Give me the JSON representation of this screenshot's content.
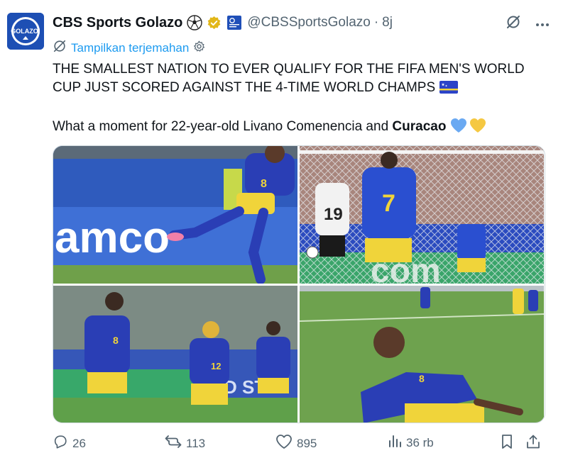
{
  "post": {
    "author_name": "CBS Sports Golazo",
    "handle": "@CBSSportsGolazo",
    "separator": "·",
    "time": "8j",
    "avatar_text": "GOLAZO!",
    "translate_label": "Tampilkan terjemahan",
    "text_line1": "THE SMALLEST NATION TO EVER QUALIFY FOR THE FIFA MEN'S WORLD",
    "text_line2": "CUP JUST SCORED AGAINST THE 4-TIME WORLD CHAMPS",
    "text_line3_prefix": "What a moment for 22-year-old Livano Comenencia and ",
    "text_line3_bold": "Curacao"
  },
  "media": {
    "photo1": {
      "banner_text": "amco",
      "jersey_number": "8"
    },
    "photo2": {
      "player_number_white": "19",
      "player_number_blue": "7"
    },
    "photo3": {
      "jersey_left": "8",
      "jersey_mid": "12"
    },
    "photo4": {
      "jersey": "8"
    }
  },
  "actions": {
    "replies": "26",
    "reposts": "113",
    "likes": "895",
    "views": "36 rb"
  },
  "colors": {
    "link_blue": "#1d9bf0",
    "muted_gray": "#536471",
    "brand_blue": "#1d4fb4",
    "verified_gold": "#e2b719",
    "curacao_blue": "#2b43c8",
    "curacao_yellow": "#f0d43a"
  },
  "icons": {
    "ball": "soccer-ball-icon",
    "verified": "verified-badge-icon",
    "affiliate": "cbs-sports-affiliate-icon",
    "grok": "grok-icon",
    "more": "more-options-icon",
    "translate": "translate-icon",
    "settings": "settings-gear-icon",
    "flag": "curacao-flag-icon",
    "reply": "reply-icon",
    "repost": "repost-icon",
    "like": "like-icon",
    "views": "views-icon",
    "bookmark": "bookmark-icon",
    "share": "share-icon"
  }
}
